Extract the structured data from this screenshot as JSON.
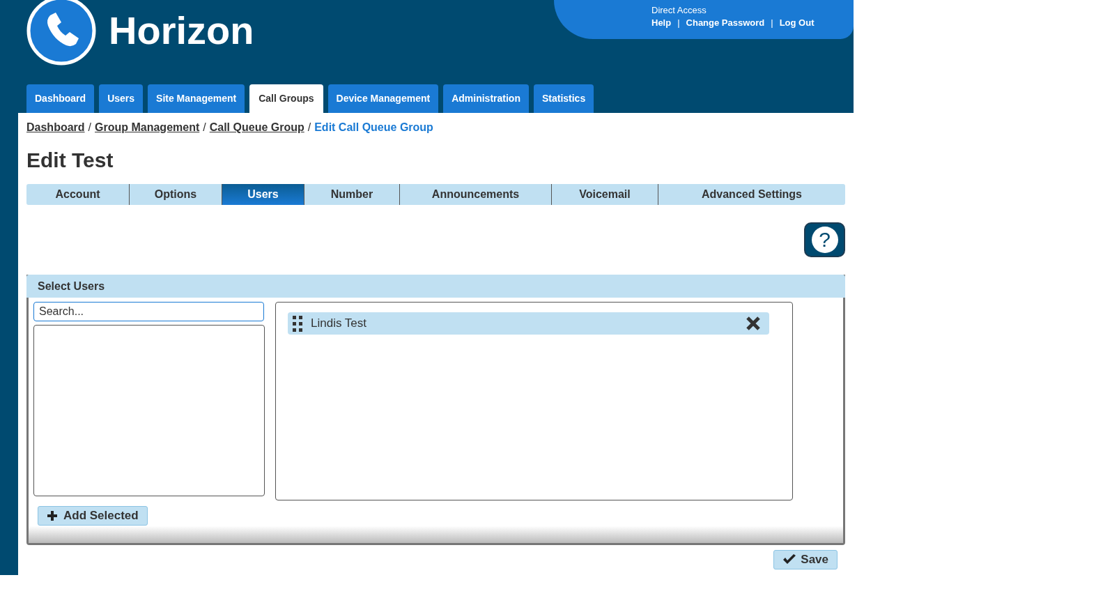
{
  "header": {
    "logo_text": "Horizon",
    "account_line": "Direct Access",
    "links": [
      "Help",
      "Change Password",
      "Log Out"
    ],
    "link_separator": "|"
  },
  "nav_tabs": [
    {
      "label": "Dashboard",
      "selected": false
    },
    {
      "label": "Users",
      "selected": false
    },
    {
      "label": "Site Management",
      "selected": false
    },
    {
      "label": "Call Groups",
      "selected": true
    },
    {
      "label": "Device Management",
      "selected": false
    },
    {
      "label": "Administration",
      "selected": false
    },
    {
      "label": "Statistics",
      "selected": false
    }
  ],
  "breadcrumb": [
    {
      "label": "Dashboard",
      "current": false
    },
    {
      "label": "Group Management",
      "current": false
    },
    {
      "label": "Call Queue Group",
      "current": false
    },
    {
      "label": "Edit Call Queue Group",
      "current": true
    }
  ],
  "breadcrumb_separator": "/",
  "page_title": "Edit Test",
  "sub_tabs": [
    {
      "label": "Account",
      "selected": false
    },
    {
      "label": "Options",
      "selected": false
    },
    {
      "label": "Users",
      "selected": true
    },
    {
      "label": "Number",
      "selected": false
    },
    {
      "label": "Announcements",
      "selected": false
    },
    {
      "label": "Voicemail",
      "selected": false
    },
    {
      "label": "Advanced Settings",
      "selected": false
    }
  ],
  "help_button": "?",
  "select_users": {
    "title": "Select Users",
    "search": {
      "placeholder": "Search..."
    },
    "selected_users": [
      {
        "name": "Lindis Test"
      }
    ],
    "add_button": "Add Selected"
  },
  "save_button": "Save"
}
